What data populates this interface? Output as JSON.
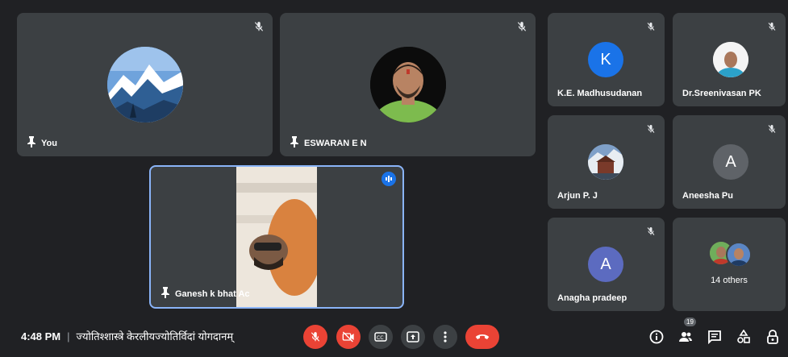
{
  "participants": {
    "you": {
      "name": "You"
    },
    "eswaran": {
      "name": "ESWARAN E N"
    },
    "ganesh": {
      "name": "Ganesh k bhat Ac"
    },
    "madhusudanan": {
      "name": "K.E. Madhusudanan",
      "initial": "K",
      "color": "#1a73e8"
    },
    "sreenivasan": {
      "name": "Dr.Sreenivasan PK"
    },
    "arjun": {
      "name": "Arjun P. J"
    },
    "aneesha": {
      "name": "Aneesha Pu",
      "initial": "A",
      "color": "#5f6368"
    },
    "anagha": {
      "name": "Anagha pradeep",
      "initial": "A",
      "color": "#5c6bc0"
    },
    "others": {
      "label": "14 others"
    }
  },
  "bottom_bar": {
    "time": "4:48 PM",
    "separator": "|",
    "meeting_title": "ज्योतिश्शास्त्रे केरलीयज्योतिर्विदां योगदानम्",
    "people_count": "19"
  },
  "colors": {
    "background": "#202124",
    "tile": "#3c4043",
    "danger": "#ea4335",
    "speaking": "#1a73e8",
    "active_border": "#8ab4f8"
  }
}
